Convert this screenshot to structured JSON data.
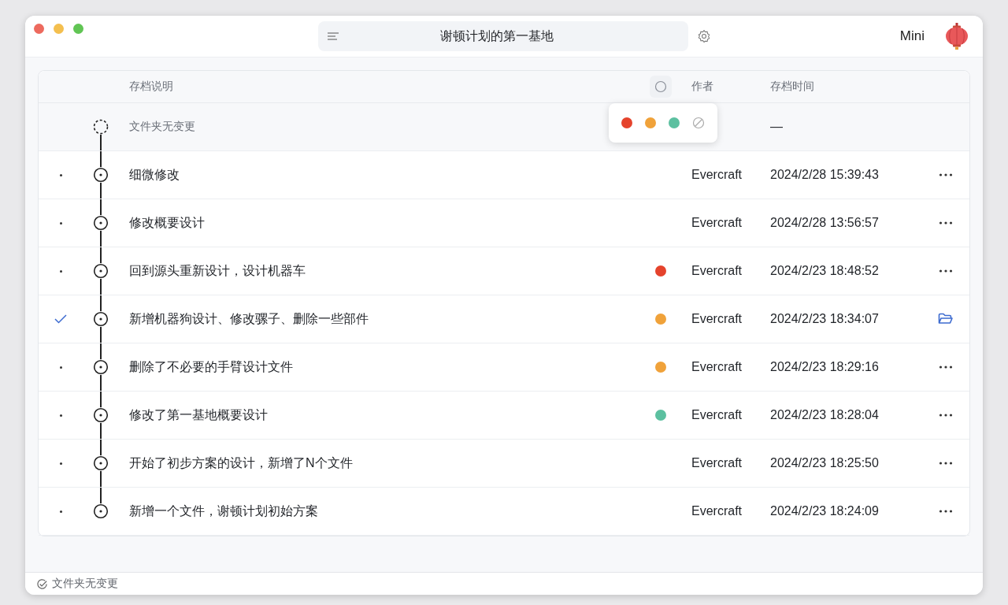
{
  "window": {
    "title": "谢顿计划的第一基地",
    "user": "Mini"
  },
  "table": {
    "columns": [
      {
        "label": "存档说明"
      },
      {
        "kind": "color-filter"
      },
      {
        "label": "作者"
      },
      {
        "label": "存档时间"
      }
    ],
    "working_row": {
      "description": "文件夹无变更",
      "time": "—"
    },
    "color_picker": {
      "options": [
        {
          "kind": "color",
          "color": "#e5432c"
        },
        {
          "kind": "color",
          "color": "#f0a23a"
        },
        {
          "kind": "color",
          "color": "#5cc0a0"
        },
        {
          "kind": "none"
        }
      ]
    },
    "rows": [
      {
        "selected": false,
        "description": "细微修改",
        "author": "Evercraft",
        "time": "2024/2/28 15:39:43",
        "kind": "more"
      },
      {
        "selected": false,
        "description": "修改概要设计",
        "author": "Evercraft",
        "time": "2024/2/28 13:56:57",
        "kind": "more"
      },
      {
        "selected": false,
        "description": "回到源头重新设计，设计机器车",
        "color": "#e5432c",
        "author": "Evercraft",
        "time": "2024/2/23 18:48:52",
        "kind": "more"
      },
      {
        "selected": true,
        "description": "新增机器狗设计、修改骡子、删除一些部件",
        "color": "#f0a23a",
        "author": "Evercraft",
        "time": "2024/2/23 18:34:07",
        "kind": "open-folder"
      },
      {
        "selected": false,
        "description": "删除了不必要的手臂设计文件",
        "color": "#f0a23a",
        "author": "Evercraft",
        "time": "2024/2/23 18:29:16",
        "kind": "more"
      },
      {
        "selected": false,
        "description": "修改了第一基地概要设计",
        "color": "#5cc0a0",
        "author": "Evercraft",
        "time": "2024/2/23 18:28:04",
        "kind": "more"
      },
      {
        "selected": false,
        "description": "开始了初步方案的设计，新增了N个文件",
        "author": "Evercraft",
        "time": "2024/2/23 18:25:50",
        "kind": "more"
      },
      {
        "selected": false,
        "description": "新增一个文件，谢顿计划初始方案",
        "author": "Evercraft",
        "time": "2024/2/23 18:24:09",
        "kind": "more"
      }
    ]
  },
  "status_bar": {
    "text": "文件夹无变更"
  }
}
